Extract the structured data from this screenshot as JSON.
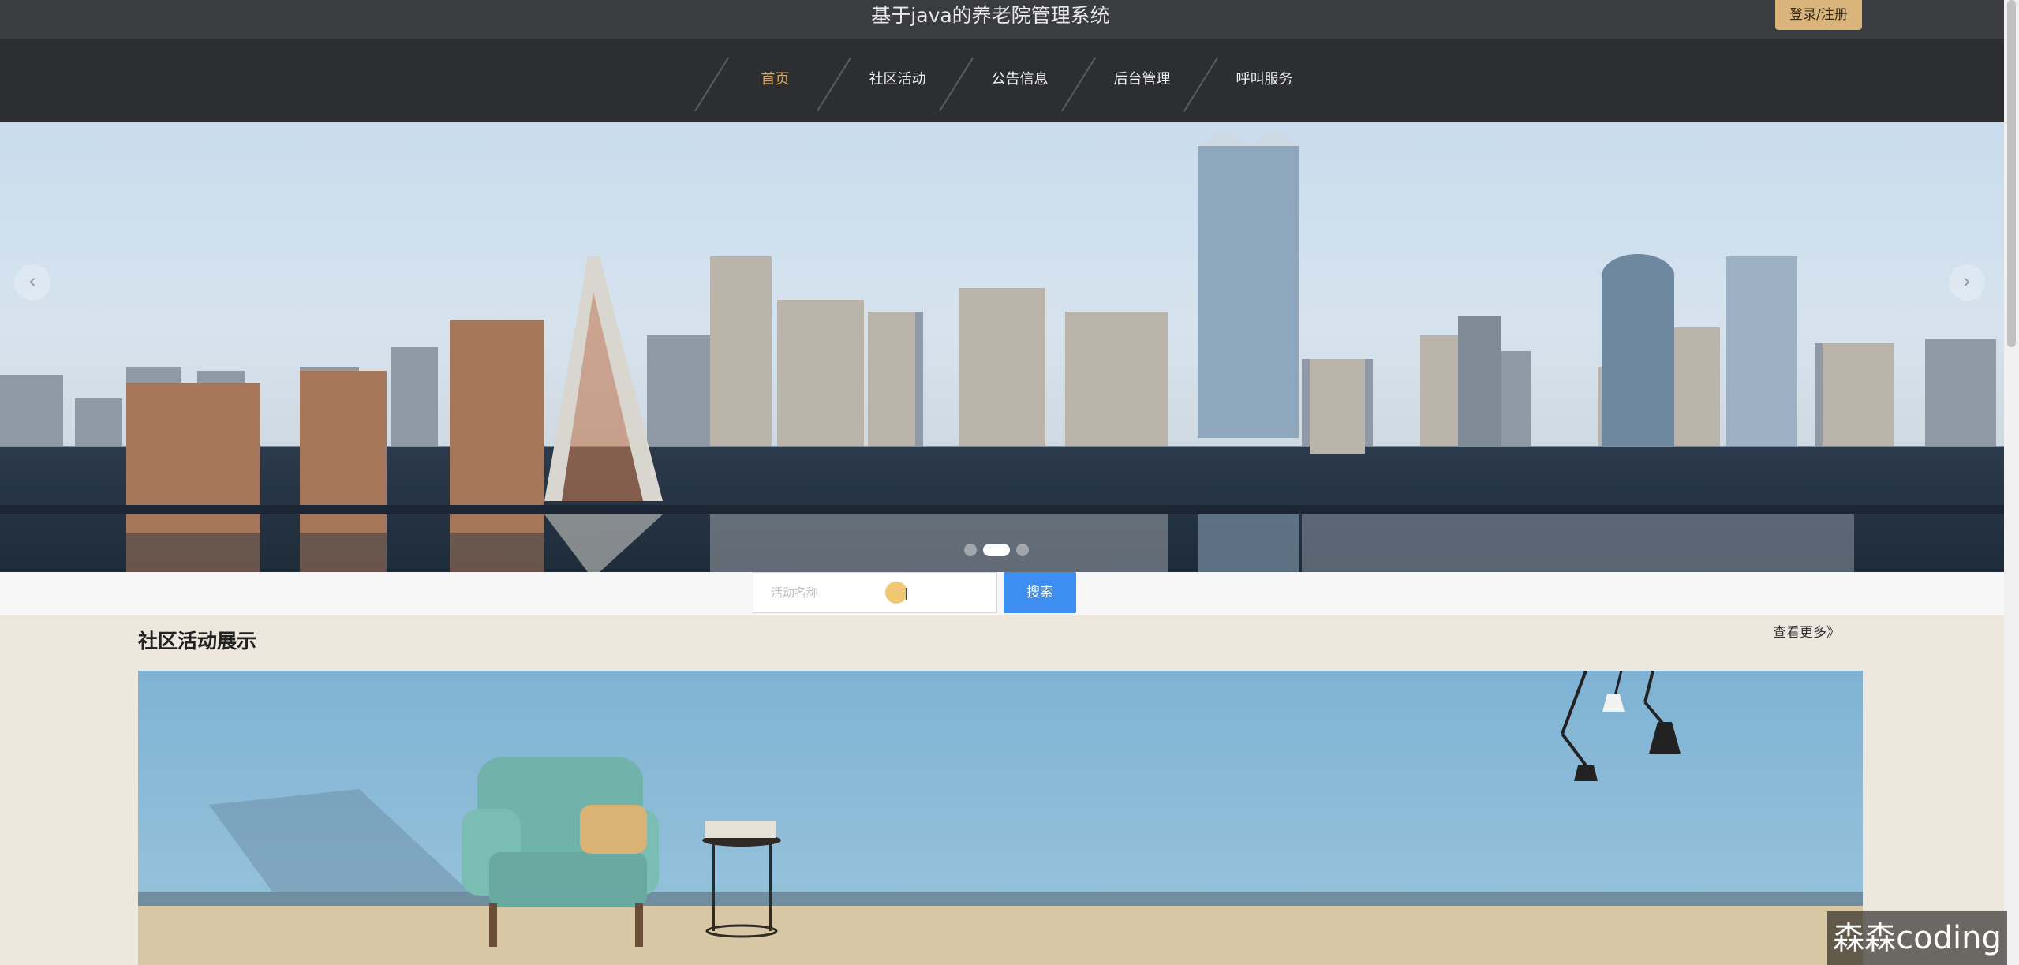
{
  "header": {
    "site_title": "基于java的养老院管理系统",
    "login_label": "登录/注册"
  },
  "nav": {
    "items": [
      {
        "label": "首页",
        "active": true
      },
      {
        "label": "社区活动",
        "active": false
      },
      {
        "label": "公告信息",
        "active": false
      },
      {
        "label": "后台管理",
        "active": false
      },
      {
        "label": "呼叫服务",
        "active": false
      }
    ]
  },
  "banner": {
    "prev_icon": "chevron-left-icon",
    "next_icon": "chevron-right-icon",
    "active_slide": 2,
    "slide_count": 3
  },
  "search": {
    "placeholder": "活动名称",
    "button_label": "搜索"
  },
  "section": {
    "title": "社区活动展示",
    "more_label": "查看更多》"
  },
  "watermark": "森森coding",
  "colors": {
    "accent": "#d8a55a",
    "primary_button": "#3d8ef0",
    "nav_bg": "#2c2e31"
  }
}
